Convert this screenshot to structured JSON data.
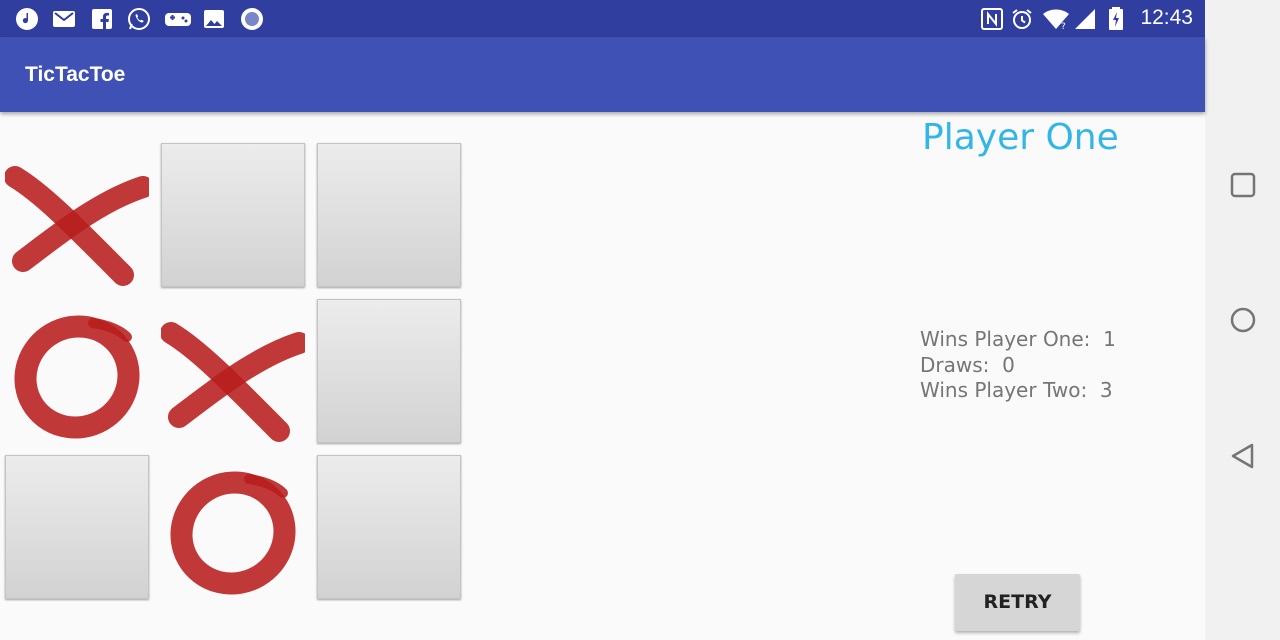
{
  "status_bar": {
    "time": "12:43",
    "notification_icons": [
      "music-icon",
      "mail-icon",
      "facebook-icon",
      "whatsapp-icon",
      "gamepad-icon",
      "image-icon",
      "circle-app-icon"
    ],
    "system_icons": [
      "nfc-icon",
      "alarm-icon",
      "wifi-icon",
      "cell-signal-icon",
      "battery-icon"
    ]
  },
  "app": {
    "title": "TicTacToe"
  },
  "board": {
    "cells": [
      "X",
      "",
      "",
      "O",
      "X",
      "",
      "",
      "O",
      ""
    ],
    "mark_color": "#b71c1c"
  },
  "game": {
    "current_turn": "Player One",
    "stats": {
      "wins_one_label": "Wins Player One:",
      "wins_one": "1",
      "draws_label": "Draws:",
      "draws": "0",
      "wins_two_label": "Wins Player Two:",
      "wins_two": "3"
    },
    "retry_label": "RETRY"
  },
  "nav_bar": {
    "buttons": [
      "recents-button",
      "home-button",
      "back-button"
    ]
  },
  "colors": {
    "status_bar": "#303f9f",
    "app_bar": "#3f51b5",
    "turn_text": "#33b5e5"
  }
}
